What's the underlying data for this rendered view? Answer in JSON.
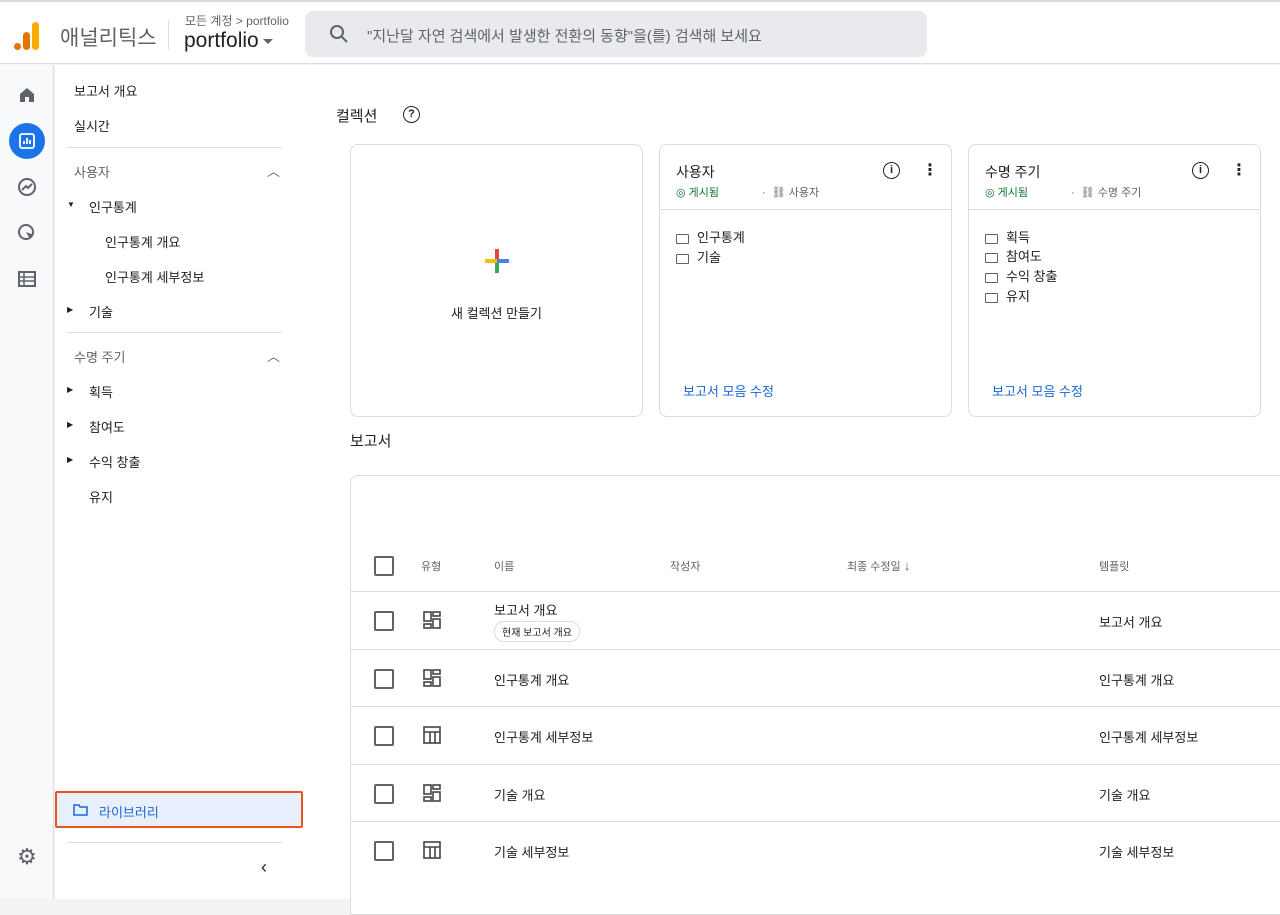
{
  "header": {
    "brand": "애널리틱스",
    "breadcrumb": "모든 계정 > portfolio",
    "property": "portfolio",
    "search_placeholder": "\"지난달 자연 검색에서 발생한 전환의 동향\"을(를) 검색해 보세요"
  },
  "nav": {
    "overview": "보고서 개요",
    "realtime": "실시간",
    "user_section": "사용자",
    "demographics": "인구통계",
    "demo_overview": "인구통계 개요",
    "demo_details": "인구통계 세부정보",
    "tech": "기술",
    "lifecycle_section": "수명 주기",
    "acquisition": "획득",
    "engagement": "참여도",
    "monetization": "수익 창출",
    "retention": "유지",
    "library": "라이브러리"
  },
  "collections": {
    "title": "컬렉션",
    "create": "새 컬렉션 만들기",
    "cards": [
      {
        "title": "사용자",
        "status": "게시됨",
        "source": "사용자",
        "folders": [
          "인구통계",
          "기술"
        ],
        "edit": "보고서 모음 수정"
      },
      {
        "title": "수명 주기",
        "status": "게시됨",
        "source": "수명 주기",
        "folders": [
          "획득",
          "참여도",
          "수익 창출",
          "유지"
        ],
        "edit": "보고서 모음 수정"
      }
    ]
  },
  "reports": {
    "title": "보고서",
    "columns": [
      "유형",
      "이름",
      "작성자",
      "최종 수정일",
      "템플릿"
    ],
    "rows": [
      {
        "type": "overview",
        "name": "보고서 개요",
        "badge": "현재 보고서 개요",
        "template": "보고서 개요"
      },
      {
        "type": "overview",
        "name": "인구통계 개요",
        "template": "인구통계 개요"
      },
      {
        "type": "detail",
        "name": "인구통계 세부정보",
        "template": "인구통계 세부정보"
      },
      {
        "type": "overview",
        "name": "기술 개요",
        "template": "기술 개요"
      },
      {
        "type": "detail",
        "name": "기술 세부정보",
        "template": "기술 세부정보"
      }
    ]
  }
}
